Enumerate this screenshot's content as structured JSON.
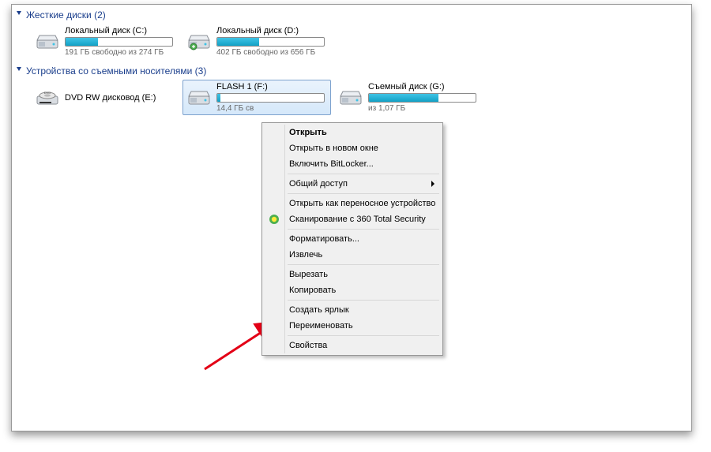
{
  "groups": {
    "hdd": {
      "title": "Жесткие диски",
      "count": "(2)"
    },
    "removable": {
      "title": "Устройства со съемными носителями",
      "count": "(3)"
    }
  },
  "drives": {
    "c": {
      "label": "Локальный диск (C:)",
      "sub": "191 ГБ свободно из 274 ГБ",
      "fill_pct": 30,
      "fill_color": "teal"
    },
    "d": {
      "label": "Локальный диск (D:)",
      "sub": "402 ГБ свободно из 656 ГБ",
      "fill_pct": 39,
      "fill_color": "teal"
    },
    "e": {
      "label": "DVD RW дисковод (E:)",
      "sub": "",
      "fill_pct": 0
    },
    "f": {
      "label": "FLASH 1 (F:)",
      "sub": "14,4 ГБ св",
      "fill_pct": 3,
      "fill_color": "teal"
    },
    "g": {
      "label": "Съемный диск (G:)",
      "sub": "из 1,07 ГБ",
      "fill_pct": 65,
      "fill_color": "teal"
    }
  },
  "ctx": {
    "open": "Открыть",
    "open_new": "Открыть в новом окне",
    "bitlocker": "Включить BitLocker...",
    "share": "Общий доступ",
    "portable": "Открыть как переносное устройство",
    "scan360": "Сканирование с 360 Total Security",
    "format": "Форматировать...",
    "eject": "Извлечь",
    "cut": "Вырезать",
    "copy": "Копировать",
    "shortcut": "Создать ярлык",
    "rename": "Переименовать",
    "props": "Свойства"
  }
}
